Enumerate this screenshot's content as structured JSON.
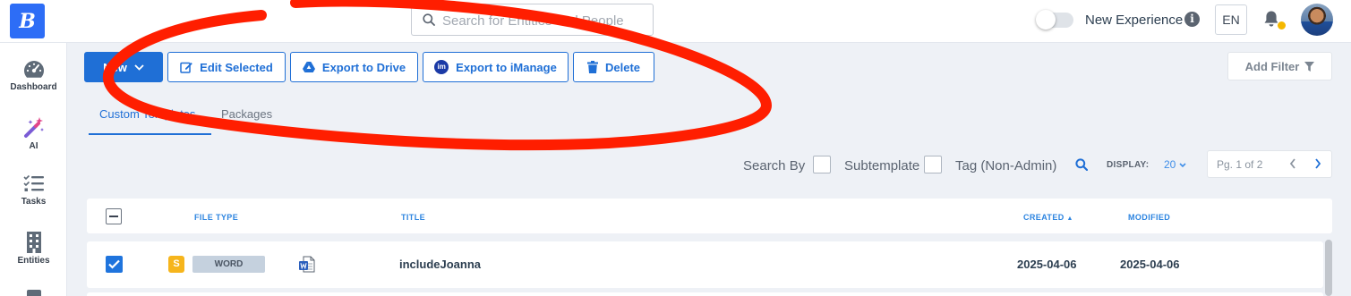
{
  "topbar": {
    "logo_text": "B",
    "search_placeholder": "Search for Entities and People",
    "new_experience_label": "New Experience",
    "new_experience_on": false,
    "info_glyph": "i",
    "language": "EN"
  },
  "sidebar": {
    "items": [
      {
        "label": "Dashboard",
        "icon": "gauge-icon"
      },
      {
        "label": "AI",
        "icon": "magic-wand-icon"
      },
      {
        "label": "Tasks",
        "icon": "checklist-icon"
      },
      {
        "label": "Entities",
        "icon": "building-icon"
      }
    ]
  },
  "toolbar": {
    "new_label": "New",
    "edit_label": "Edit Selected",
    "drive_label": "Export to Drive",
    "imanage_label": "Export to iManage",
    "imanage_badge": "im",
    "delete_label": "Delete",
    "add_filter_label": "Add Filter"
  },
  "tabs": [
    {
      "label": "Custom Templates",
      "active": true
    },
    {
      "label": "Packages",
      "active": false
    }
  ],
  "filters": {
    "search_by_label": "Search By",
    "subtemplate_label": "Subtemplate",
    "tag_label": "Tag (Non-Admin)",
    "display_label": "DISPLAY:",
    "display_value": "20",
    "page_text": "Pg. 1 of 2"
  },
  "table": {
    "columns": {
      "file_type": "FILE TYPE",
      "title": "TITLE",
      "created": "CREATED",
      "modified": "MODIFIED"
    },
    "sort_column": "created",
    "sort_indicator": "▲",
    "rows": [
      {
        "selected": true,
        "status_badge": "S",
        "file_type": "WORD",
        "title": "includeJoanna",
        "created": "2025-04-06",
        "modified": "2025-04-06"
      }
    ]
  },
  "colors": {
    "accent": "#1f6fd6",
    "logo": "#2d6df6",
    "annotation": "#ff1e00",
    "status_badge": "#f6b51c",
    "notification_dot": "#f5b800"
  }
}
